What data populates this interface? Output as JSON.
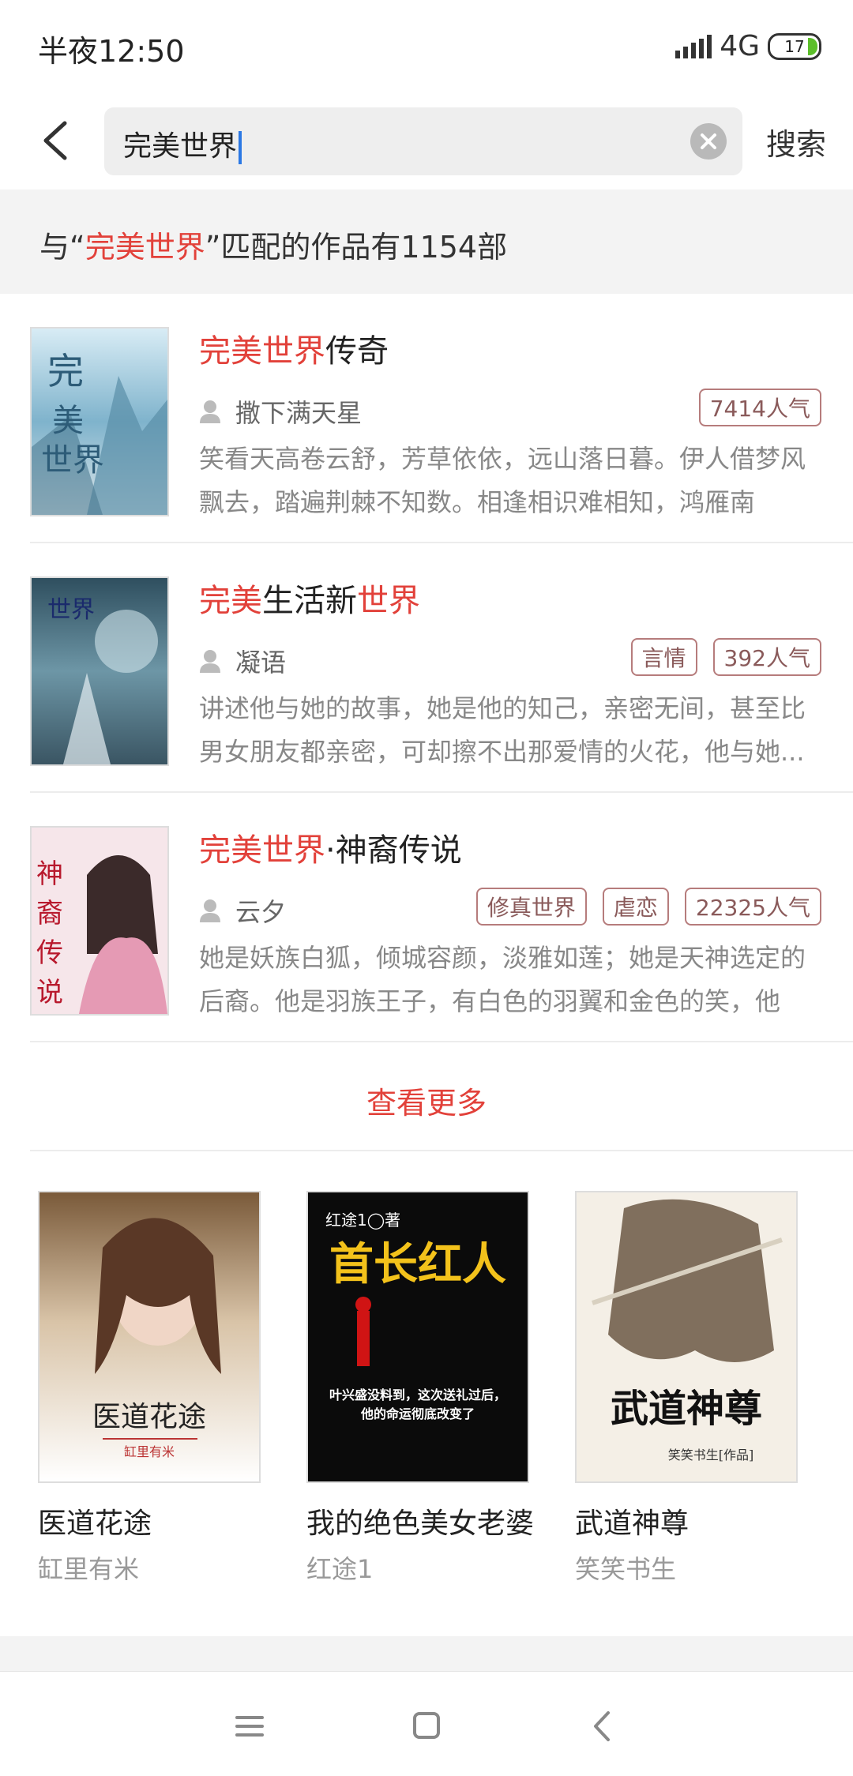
{
  "status_bar": {
    "time": "半夜12:50",
    "network": "4G",
    "battery": "17"
  },
  "search": {
    "query": "完美世界",
    "button_label": "搜索"
  },
  "result_summary": {
    "prefix": "与“",
    "keyword": "完美世界",
    "suffix": "”匹配的作品有1154部"
  },
  "results": [
    {
      "title_red": "完美世界",
      "title_rest": "传奇",
      "author": "撒下满天星",
      "tags": [
        "7414人气"
      ],
      "desc": "笑看天高卷云舒，芳草依依，远山落日暮。伊人借梦风飘去，踏遍荆棘不知数。相逢相识难相知，鸿雁南飞，..."
    },
    {
      "title_red": "完美",
      "title_mid": "生活新",
      "title_red2": "世界",
      "author": "凝语",
      "tags": [
        "言情",
        "392人气"
      ],
      "desc": "讲述他与她的故事，她是他的知己，亲密无间，甚至比男女朋友都亲密，可却擦不出那爱情的火花，他与她..."
    },
    {
      "title_red": "完美世界",
      "title_rest": "·神裔传说",
      "author": "云夕",
      "tags": [
        "修真世界",
        "虐恋",
        "22325人气"
      ],
      "desc": "她是妖族白狐，倾城容颜，淡雅如莲；她是天神选定的后裔。他是羽族王子，有白色的羽翼和金色的笑，他的..."
    }
  ],
  "more_label": "查看更多",
  "recommendations": [
    {
      "name": "医道花途",
      "author": "缸里有米",
      "cover_text": "医道花途",
      "cover_sub": "缸里有米"
    },
    {
      "name": "我的绝色美女老婆",
      "author": "红途1",
      "cover_text": "首长红人",
      "cover_top": "红途1◯著",
      "cover_line1": "叶兴盛没料到，这次送礼过后，",
      "cover_line2": "他的命运彻底改变了"
    },
    {
      "name": "武道神尊",
      "author": "笑笑书生",
      "cover_text": "武道神尊",
      "cover_sub": "笑笑书生[作品]"
    }
  ],
  "colors": {
    "accent": "#e2413a",
    "tag_border": "#b67c7c",
    "background_gray": "#f3f3f3"
  }
}
